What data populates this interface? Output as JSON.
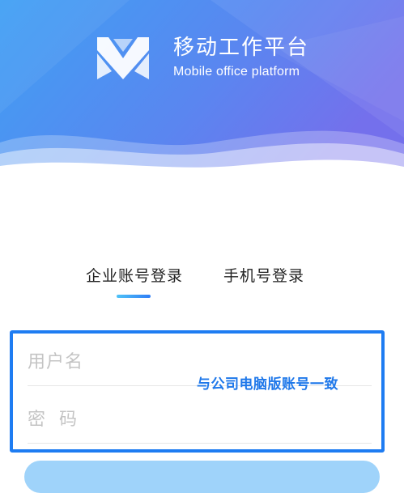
{
  "header": {
    "title": "移动工作平台",
    "subtitle": "Mobile office platform",
    "logo_icon": "m-letter-logo-icon",
    "gradient_colors": [
      "#3fa3f5",
      "#6c74ee"
    ]
  },
  "tabs": [
    {
      "label": "企业账号登录",
      "active": true
    },
    {
      "label": "手机号登录",
      "active": false
    }
  ],
  "form": {
    "username_placeholder": "用户名",
    "password_placeholder": "密  码",
    "hint": "与公司电脑版账号一致"
  },
  "colors": {
    "accent": "#1e7cf2",
    "login_button": "#9fd3fa"
  }
}
